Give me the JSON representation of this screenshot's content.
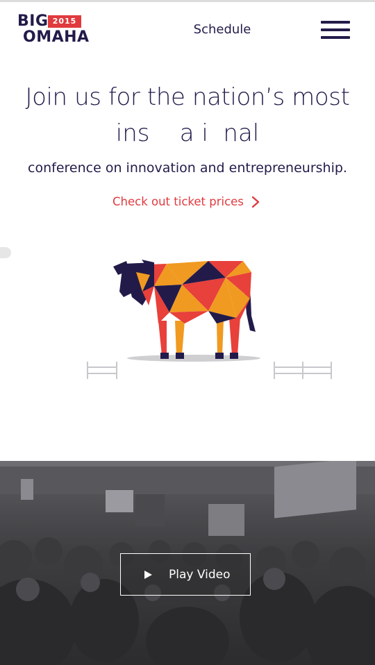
{
  "header": {
    "logo_top": "BIG",
    "logo_year": "2015",
    "logo_bottom": "OMAHA",
    "nav_link": "Schedule",
    "menu_icon": "hamburger-menu-icon"
  },
  "hero": {
    "headline": "Join us for the nation’s most",
    "rotating_word": "ins    a i  nal",
    "subline": "conference on innovation and entrepreneurship.",
    "cta_label": "Check out ticket prices",
    "cta_icon": "chevron-right-icon"
  },
  "video": {
    "button_label": "Play Video",
    "button_icon": "play-icon"
  },
  "colors": {
    "navy": "#221b4a",
    "red": "#e03a3e",
    "orange": "#f09a21",
    "video_bg": "#3b3b3d"
  }
}
